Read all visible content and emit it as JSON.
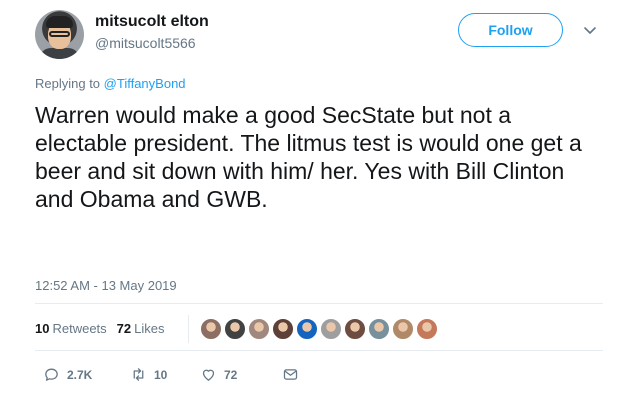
{
  "author": {
    "name": "mitsucolt elton",
    "handle": "@mitsucolt5566"
  },
  "follow_button": {
    "label": "Follow"
  },
  "reply": {
    "prefix": "Replying to",
    "to": "@TiffanyBond"
  },
  "tweet": {
    "text": "Warren would make a good SecState but not a electable president. The litmus test is would one get a beer and sit down with him/ her. Yes with Bill Clinton and Obama and GWB.",
    "timestamp": "12:52 AM - 13 May 2019"
  },
  "stats": {
    "retweets_count": "10",
    "retweets_label": "Retweets",
    "likes_count": "72",
    "likes_label": "Likes"
  },
  "likers": [
    {
      "color": "#8d6e63"
    },
    {
      "color": "#424242"
    },
    {
      "color": "#a1887f"
    },
    {
      "color": "#5d4037"
    },
    {
      "color": "#1565c0"
    },
    {
      "color": "#9e9e9e"
    },
    {
      "color": "#6d4c41"
    },
    {
      "color": "#78909c"
    },
    {
      "color": "#b08968"
    },
    {
      "color": "#c47a5a"
    }
  ],
  "actions": {
    "reply_count": "2.7K",
    "retweet_count": "10",
    "like_count": "72"
  },
  "colors": {
    "accent": "#1da1f2",
    "secondary_text": "#657786",
    "primary_text": "#14171a",
    "divider": "#e6ecf0"
  }
}
